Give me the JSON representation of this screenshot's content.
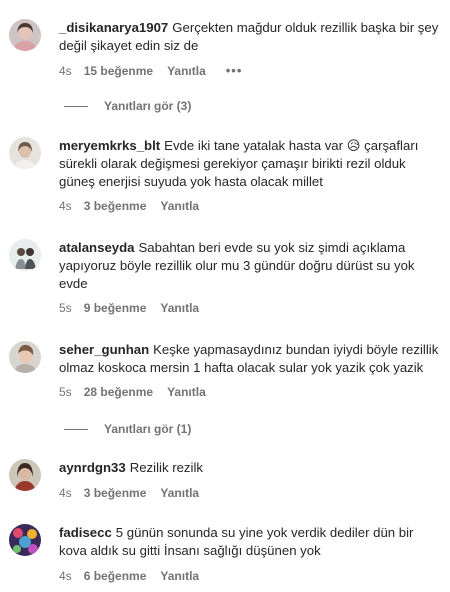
{
  "comments": [
    {
      "username": "_disikanarya1907",
      "text": "Gerçekten mağdur olduk rezillik başka bir şey değil şikayet edin siz de",
      "time": "4s",
      "likes": "15 beğenme",
      "reply": "Yanıtla",
      "more": "•••",
      "view_replies": "Yanıtları gör (3)"
    },
    {
      "username": "meryemkrks_blt",
      "text_before_emoji": "Evde iki tane yatalak hasta var",
      "emoji": "😥",
      "text_after_emoji": "çarşafları sürekli olarak değişmesi gerekiyor çamaşır birikti rezil olduk güneş enerjisi suyuda yok hasta olacak millet",
      "time": "4s",
      "likes": "3 beğenme",
      "reply": "Yanıtla"
    },
    {
      "username": "atalanseyda",
      "text": "Sabahtan beri evde su yok siz şimdi açıklama yapıyoruz böyle rezillik olur mu 3 gündür doğru dürüst su yok evde",
      "time": "5s",
      "likes": "9 beğenme",
      "reply": "Yanıtla"
    },
    {
      "username": "seher_gunhan",
      "text": "Keşke yapmasaydınız bundan iyiydi böyle rezillik olmaz koskoca mersin 1 hafta olacak sular yok yazik çok yazik",
      "time": "5s",
      "likes": "28 beğenme",
      "reply": "Yanıtla",
      "view_replies": "Yanıtları gör (1)"
    },
    {
      "username": "aynrdgn33",
      "text": "Rezilik rezilk",
      "time": "4s",
      "likes": "3 beğenme",
      "reply": "Yanıtla"
    },
    {
      "username": "fadisecc",
      "text": "5 günün sonunda su yine yok verdik dediler dün bir kova aldık su gitti İnsanı sağlığı düşünen yok",
      "time": "4s",
      "likes": "6 beğenme",
      "reply": "Yanıtla"
    }
  ]
}
